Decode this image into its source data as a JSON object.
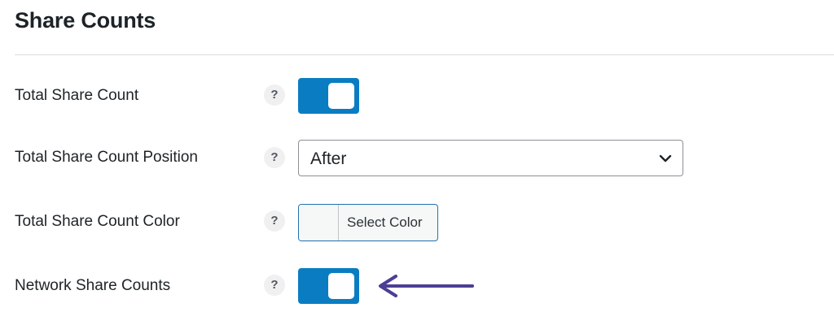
{
  "section": {
    "title": "Share Counts"
  },
  "rows": [
    {
      "label": "Total Share Count",
      "help": "?",
      "control": "toggle",
      "state": "on"
    },
    {
      "label": "Total Share Count Position",
      "help": "?",
      "control": "select",
      "value": "After"
    },
    {
      "label": "Total Share Count Color",
      "help": "?",
      "control": "color-picker",
      "button_label": "Select Color"
    },
    {
      "label": "Network Share Counts",
      "help": "?",
      "control": "toggle",
      "state": "on"
    }
  ],
  "colors": {
    "accent": "#0a7dc2",
    "arrow": "#4b3f94",
    "divider": "#dcdcde",
    "text": "#1d2327"
  },
  "icons": {
    "select": "chevron-down-icon",
    "annotation": "arrow-left-icon"
  }
}
